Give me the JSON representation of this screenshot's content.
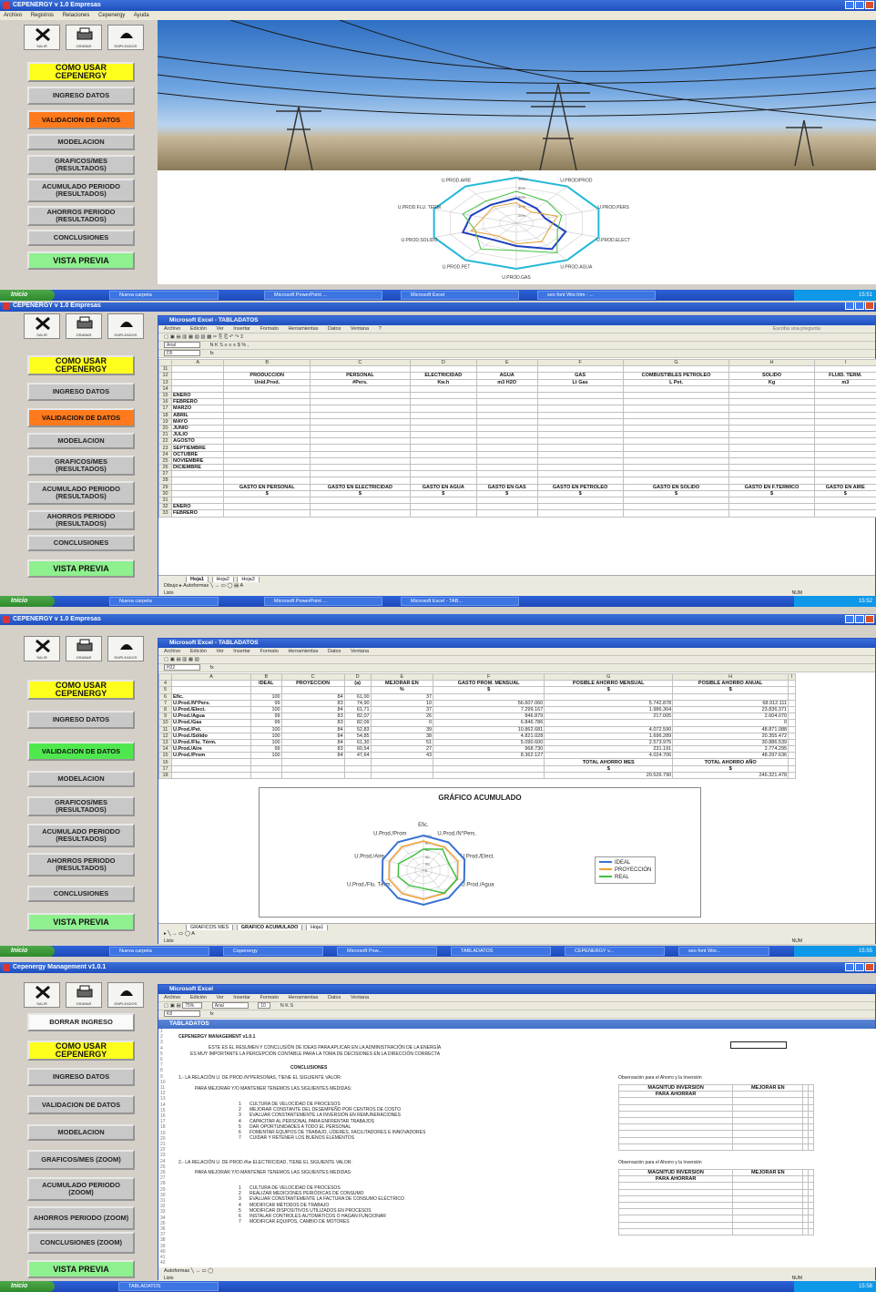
{
  "screens": [
    {
      "window_title": "CEPENERGY v 1.0 Empresas",
      "menu": [
        "Archivo",
        "Registros",
        "Relaciones",
        "Cepenergy",
        "Ayuda"
      ],
      "taskbar": {
        "start": "Inicio",
        "tasks": [
          "Nueva carpeta",
          "Microsoft PowerPoint ...",
          "Microsoft Excel",
          "seo font Wor.htm - ..."
        ],
        "clock": "15:51"
      },
      "radar_labels": [
        "BENO",
        "U.PROD/PROD",
        "U.PROD.PERS",
        "U.PROD.ELECT",
        "U.PROD.AGUA",
        "U.PROD.GAS",
        "U.PROD.PET",
        "U.PROD.SOLIDO",
        "U.PROD.FLU. TERM",
        "U.PROD.AIRE"
      ],
      "radar_ticks": [
        "100%",
        "80%",
        "60%",
        "40%",
        "20%"
      ]
    },
    {
      "window_title": "CEPENERGY v 1.0 Empresas",
      "excel_title": "Microsoft Excel - TABLADATOS",
      "excel_menu": [
        "Archivo",
        "Edición",
        "Ver",
        "Insertar",
        "Formato",
        "Herramientas",
        "Datos",
        "Ventana",
        "?"
      ],
      "help_placeholder": "Escriba una pregunta",
      "cell_ref": "D5",
      "font": "Arial",
      "columns": [
        "A",
        "B",
        "C",
        "D",
        "E",
        "F",
        "G",
        "H",
        "I"
      ],
      "header_row": [
        "PRODUCCIÓN",
        "PERSONAL",
        "ELECTRICIDAD",
        "AGUA",
        "GAS",
        "COMBUSTIBLES PETRÓLEO",
        "SÓLIDO",
        "FLUID. TERM."
      ],
      "unit_row": [
        "Unid.Prod.",
        "#Pers.",
        "Kw.h",
        "m3 H2O",
        "Lt Gas",
        "L Pet.",
        "Kg",
        "m3"
      ],
      "months": [
        "ENERO",
        "FEBRERO",
        "MARZO",
        "ABRIL",
        "MAYO",
        "JUNIO",
        "JULIO",
        "AGOSTO",
        "SEPTIEMBRE",
        "OCTUBRE",
        "NOVIEMBRE",
        "DICIEMBRE"
      ],
      "gasto_row": [
        "GASTO EN PERSONAL",
        "GASTO EN ELECTRICIDAD",
        "GASTO EN AGUA",
        "GASTO EN GAS",
        "GASTO EN PETROLEO",
        "GASTO EN SOLIDO",
        "GASTO EN F.TERMICO",
        "GASTO EN AIRE"
      ],
      "gasto_unit": [
        "$",
        "$",
        "$",
        "$",
        "$",
        "$",
        "$",
        "$"
      ],
      "months2": [
        "ENERO",
        "FEBRERO"
      ],
      "tabs": [
        "Hoja1",
        "Hoja2",
        "Hoja3"
      ],
      "draw": "Dibujo",
      "autoshapes": "Autoformas",
      "status": "Listo",
      "num": "NUM",
      "taskbar": {
        "start": "Inicio",
        "tasks": [
          "Nueva carpeta",
          "Microsoft PowerPoint ...",
          "Microsoft Excel - TAB..."
        ],
        "clock": "15:52"
      }
    },
    {
      "window_title": "CEPENERGY v 1.0 Empresas",
      "excel_title": "Microsoft Excel - TABLADATOS",
      "cell_ref": "H22",
      "columns": [
        "A",
        "B",
        "C",
        "D",
        "E",
        "F",
        "G",
        "H",
        "I"
      ],
      "headers": [
        "",
        "IDEAL",
        "PROYECCION",
        "(a)",
        "MEJORAR EN",
        "GASTO PROM. MENSUAL",
        "POSIBLE AHORRO MENSUAL",
        "POSIBLE AHORRO ANUAL"
      ],
      "subheaders": [
        "",
        "",
        "",
        "",
        "%",
        "$",
        "$",
        "$"
      ],
      "rows": [
        [
          "Efic.",
          "100",
          "84",
          "61,00",
          "37",
          "",
          "",
          ""
        ],
        [
          "U.Prod./N°Pers.",
          "99",
          "83",
          "74,90",
          "10",
          "56.607.060",
          "5.742.878",
          "68.912.111"
        ],
        [
          "U.Prod./Elect.",
          "100",
          "84",
          "61,71",
          "37",
          "7.299.167",
          "1.986.364",
          "23.836.371"
        ],
        [
          "U.Prod./Agua",
          "99",
          "83",
          "82,07",
          "26",
          "846.879",
          "217.005",
          "2.604.070"
        ],
        [
          "U.Prod./Gas",
          "99",
          "83",
          "82,09",
          "0",
          "6.846.786",
          "",
          "0"
        ],
        [
          "U.Prod./Pet.",
          "100",
          "84",
          "52,83",
          "39",
          "10.862.681",
          "4.072.590",
          "48.871.088"
        ],
        [
          "U.Prod./Sólido",
          "100",
          "84",
          "54,85",
          "38",
          "4.821.028",
          "1.696.289",
          "20.355.472"
        ],
        [
          "U.Prod./Flu. Térm.",
          "100",
          "84",
          "61,30",
          "51",
          "5.090.600",
          "2.573.975",
          "30.886.539"
        ],
        [
          "U.Prod./Aire",
          "99",
          "83",
          "60,54",
          "27",
          "968.730",
          "231.191",
          "2.774.295"
        ],
        [
          "U.Prod./Prom",
          "100",
          "84",
          "47,64",
          "43",
          "8.362.127",
          "4.024.706",
          "48.297.636"
        ]
      ],
      "total_labels": [
        "TOTAL AHORRO MES",
        "TOTAL AHORRO AÑO"
      ],
      "totals": [
        "$",
        "$",
        "20.526.790",
        "246.321.478"
      ],
      "chart_title": "GRÁFICO ACUMULADO",
      "legend": [
        "IDEAL",
        "PROYECCIÓN",
        "REAL"
      ],
      "radar_labels": [
        "Efic.",
        "U.Prod./N°Pers.",
        "U.Prod./Elect.",
        "U.Prod./Agua",
        "U.Prod./Flu. Térm.",
        "U.Prod./Aire",
        "U.Prod./Prom"
      ],
      "radar_ticks": [
        "100",
        "80",
        "60",
        "40",
        "20",
        "0"
      ],
      "tabs": [
        "GRAFICOS MES",
        "GRAFICO ACUMULADO",
        "Hoja1"
      ],
      "status": "Listo",
      "num": "NUM",
      "taskbar": {
        "start": "Inicio",
        "tasks": [
          "Nueva carpeta",
          "Cepenergy",
          "Microsoft Pow...",
          "TABLADATOS",
          "CEPENERGY v...",
          "seo font Wor..."
        ],
        "clock": "15:55"
      }
    },
    {
      "window_title": "Cepenergy Management v1.0.1",
      "excel_title": "Microsoft Excel",
      "book_title": "TABLADATOS",
      "zoom": "75%",
      "font": "Arial",
      "font_size": "10",
      "cell_ref": "K8",
      "heading": "CEPENERGY MANAGEMENT v1.0.1",
      "intro": [
        "ESTE ES EL RESUMEN Y CONCLUSIÓN DE IDEAS PARA APLICAR EN LA ADMINISTRACIÓN DE LA ENERGÍA",
        "ES MUY IMPORTANTE LA PERCEPCIÓN CONTABLE PARA LA TOMA DE DECISIONES EN LA DIRECCIÓN CORRECTA"
      ],
      "conclusiones": "CONCLUSIONES",
      "section1": "1.- LA RELACIÓN U. DE PROD./N°PERSONAS, TIENE EL SIGUIENTE VALOR:",
      "section1_sub": "PARA MEJORAR Y/O MANTENER TENEMOS LAS SIGUIENTES MEDIDAS:",
      "section1_items": [
        "CULTURA DE VELOCIDAD DE PROCESOS",
        "MEJORAR CONSTANTE DEL DESEMPEÑO POR CENTROS DE COSTO",
        "EVALUAR CONSTANTEMENTE LA INVERSIÓN EN REMUNERACIONES",
        "CAPACITAR AL PERSONAL PARA ENFRENTAR TRABAJOS",
        "DAR OPORTUNIDADES A TODO EL PERSONAL",
        "FOMENTAR EQUIPOS DE TRABAJO, LÍDERES, FACILITADORES E INNOVADORES",
        "CUIDAR Y RETENER LOS BUENOS ELEMENTOS"
      ],
      "section2": "2.- LA RELACIÓN U. DE PROD./Kw ELECTRICIDAD, TIENE EL SIGUIENTE VALOR:",
      "section2_sub": "PARA MEJORAR Y/O MANTENER TENEMOS LAS SIGUIENTES MEDIDAS:",
      "section2_items": [
        "CULTURA DE VELOCIDAD DE PROCESOS",
        "REALIZAR MEDICIONES PERIÓDICAS DE CONSUMO",
        "EVALUAR CONSTANTEMENTE LA FACTURA DE CONSUMO ELÉCTRICO",
        "MODIFICAR MÉTODOS DE TRABAJO",
        "MODIFICAR DISPOSITIVOS UTILIZADOS EN PROCESOS",
        "INSTALAR CONTROLES AUTOMÁTICOS O HAGAN FUNCIONAR",
        "MODIFICAR EQUIPOS, CAMBIO DE MOTORES"
      ],
      "side_note": "Observación para el Ahorro y la Inversión",
      "side_headers": [
        "MAGNITUD INVERSIÓN",
        "MEJORAR EN"
      ],
      "side_sub": "PARA AHORRAR",
      "draw": "Autoformas",
      "status": "Listo",
      "num": "NUM",
      "taskbar": {
        "start": "Inicio",
        "tasks": [
          "TABLADATOS"
        ],
        "clock": "15:58"
      }
    }
  ],
  "sidebar": {
    "icons": [
      {
        "icon": "close-icon",
        "label": "SALIR"
      },
      {
        "icon": "printer-icon",
        "label": "GRABAR"
      },
      {
        "icon": "help-icon",
        "label": "EMPLEADOS"
      }
    ],
    "como_usar": "COMO USAR CEPENERGY",
    "ingreso": "INGRESO DATOS",
    "validacion": "VALIDACION DE DATOS",
    "modelacion": "MODELACION",
    "graficos": "GRAFICOS/MES (RESULTADOS)",
    "graficos_zoom": "GRAFICOS/MES (ZOOM)",
    "acumulado": "ACUMULADO PERIODO (RESULTADOS)",
    "acumulado_zoom": "ACUMULADO PERIODO (ZOOM)",
    "ahorros": "AHORROS PERIODO (RESULTADOS)",
    "ahorros_zoom": "AHORROS PERIODO (ZOOM)",
    "conclusiones": "CONCLUSIONES",
    "conclusiones_zoom": "CONCLUSIONES (ZOOM)",
    "vista_previa": "VISTA PREVIA",
    "borrar": "BORRAR INGRESO"
  },
  "colors": {
    "yellow": "#ffff1e",
    "orange": "#ff7a1c",
    "green": "#4ee84e",
    "ideal": "#3a72d0",
    "proyeccion": "#f0a030",
    "real": "#40c040"
  }
}
